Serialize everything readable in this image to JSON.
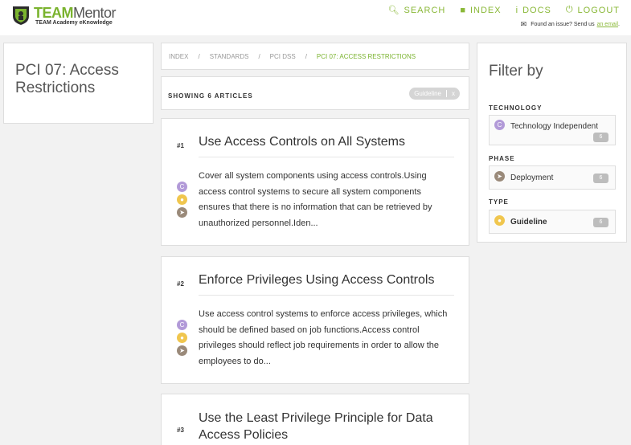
{
  "header": {
    "brand_team": "TEAM",
    "brand_mentor": "Mentor",
    "tagline": "TEAM Academy eKnowledge",
    "nav": [
      {
        "icon": "search-icon",
        "label": "SEARCH"
      },
      {
        "icon": "folder-icon",
        "label": "INDEX"
      },
      {
        "icon": "info-icon",
        "label": "DOCS"
      },
      {
        "icon": "power-icon",
        "label": "LOGOUT"
      }
    ],
    "issue_text": "Found an issue? Send us",
    "issue_link": "an email",
    "issue_end": "."
  },
  "page": {
    "title": "PCI 07: Access Restrictions"
  },
  "breadcrumb": [
    "INDEX",
    "STANDARDS",
    "PCI DSS",
    "PCI 07: ACCESS RESTRICTIONS"
  ],
  "results": {
    "showing_label": "SHOWING 6 ARTICLES",
    "active_filter": "Guideline",
    "remove_filter": "x"
  },
  "articles": [
    {
      "number": "#1",
      "title": "Use Access Controls on All Systems",
      "summary": "Cover all system components using access controls.Using access control systems to secure all system components ensures that there is no information that can be retrieved by unauthorized personnel.Iden...",
      "icons": [
        "technology-icon",
        "guideline-icon",
        "deployment-icon"
      ]
    },
    {
      "number": "#2",
      "title": "Enforce Privileges Using Access Controls",
      "summary": "Use access control systems to enforce access privileges, which should be defined based on job functions.Access control privileges should reflect job requirements in order to allow the employees to do...",
      "icons": [
        "technology-icon",
        "guideline-icon",
        "deployment-icon"
      ]
    },
    {
      "number": "#3",
      "title": "Use the Least Privilege Principle for Data Access Policies"
    }
  ],
  "filters": {
    "title": "Filter by",
    "sections": [
      {
        "name": "TECHNOLOGY",
        "items": [
          {
            "label": "Technology Independent",
            "count": "6",
            "icon": "technology-icon"
          }
        ]
      },
      {
        "name": "PHASE",
        "items": [
          {
            "label": "Deployment",
            "count": "6",
            "icon": "deployment-icon"
          }
        ]
      },
      {
        "name": "TYPE",
        "items": [
          {
            "label": "Guideline",
            "count": "6",
            "icon": "guideline-icon"
          }
        ]
      }
    ]
  },
  "colors": {
    "accent": "#8ab838",
    "technology": "#b29ad8",
    "guideline": "#f0c64e",
    "phase": "#9a8a7a"
  }
}
